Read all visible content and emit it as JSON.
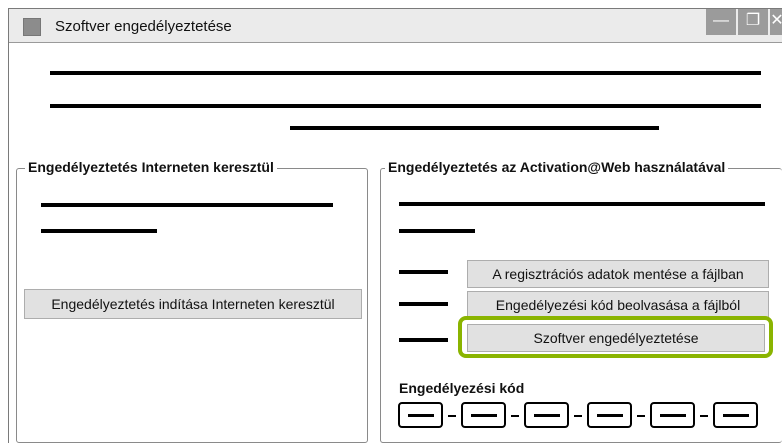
{
  "window": {
    "title": "Szoftver engedélyeztetése",
    "controls": {
      "minimize": "—",
      "maximize": "❐",
      "close": "✕"
    }
  },
  "internet_group": {
    "legend": "Engedélyeztetés Interneten keresztül",
    "start_button": "Engedélyeztetés indítása Interneten keresztül"
  },
  "web_group": {
    "legend": "Engedélyeztetés az Activation@Web használatával",
    "save_button": "A regisztrációs adatok mentése a fájlban",
    "read_button": "Engedélyezési kód beolvasása a fájlból",
    "activate_button": "Szoftver engedélyeztetése",
    "code_label": "Engedélyezési kód",
    "code_field_count": 6
  },
  "colors": {
    "highlight": "#8ab400",
    "button_bg": "#e1e1e1"
  }
}
